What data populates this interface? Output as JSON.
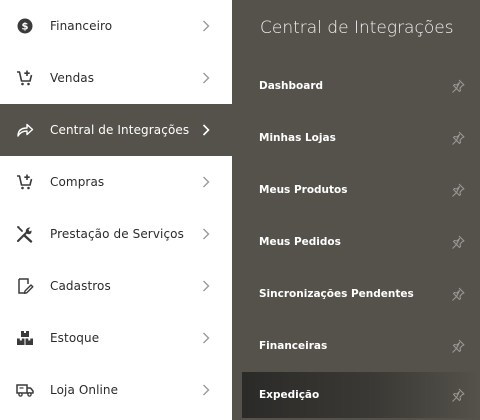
{
  "left_menu": {
    "items": [
      {
        "label": "Financeiro",
        "icon": "dollar-circle-icon"
      },
      {
        "label": "Vendas",
        "icon": "cart-add-icon"
      },
      {
        "label": "Central de Integrações",
        "icon": "share-arrow-icon",
        "active": true
      },
      {
        "label": "Compras",
        "icon": "cart-add-icon"
      },
      {
        "label": "Prestação de Serviços",
        "icon": "tools-icon"
      },
      {
        "label": "Cadastros",
        "icon": "edit-note-icon"
      },
      {
        "label": "Estoque",
        "icon": "boxes-icon"
      },
      {
        "label": "Loja Online",
        "icon": "truck-icon"
      }
    ]
  },
  "submenu": {
    "title": "Central de Integrações",
    "items": [
      {
        "label": "Dashboard"
      },
      {
        "label": "Minhas Lojas"
      },
      {
        "label": "Meus Produtos"
      },
      {
        "label": "Meus Pedidos"
      },
      {
        "label": "Sincronizações Pendentes"
      },
      {
        "label": "Financeiras"
      },
      {
        "label": "Expedição",
        "highlighted": true
      }
    ]
  },
  "colors": {
    "panel_bg": "#54524a",
    "active_bg": "#54524a",
    "text_dark": "#2b2b2b",
    "text_light": "#ffffff",
    "icon_dark": "#3a3a3a",
    "chevron": "#9a9a9a"
  }
}
